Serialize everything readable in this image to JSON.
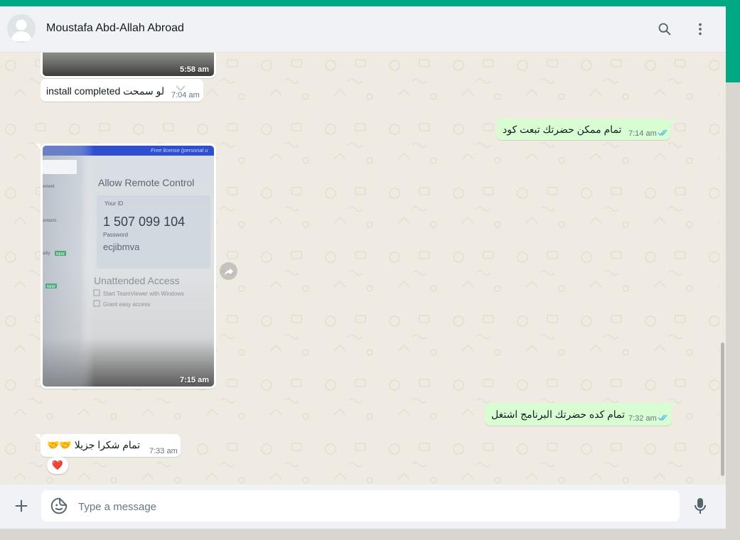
{
  "header": {
    "contact_name": "Moustafa Abd-Allah Abroad",
    "icons": [
      "search-icon",
      "menu-icon"
    ]
  },
  "messages": [
    {
      "id": "m0",
      "direction": "in",
      "type": "image",
      "time": "5:58 am"
    },
    {
      "id": "m1",
      "direction": "in",
      "type": "text",
      "text": "install completed لو سمحت",
      "time": "7:04 am"
    },
    {
      "id": "m2",
      "direction": "out",
      "type": "text",
      "text": "تمام ممكن حضرتك تبعت كود",
      "time": "7:14 am",
      "status": "read"
    },
    {
      "id": "m3",
      "direction": "in",
      "type": "image",
      "time": "7:15 am",
      "image_text": {
        "watermark": "Free license (personal u",
        "heading": "Allow Remote Control",
        "your_id_label": "Your ID",
        "your_id": "1 507 099 104",
        "password_label": "Password",
        "password": "ecjibmva",
        "unattended": "Unattended Access",
        "start_tv": "Start TeamViewer with Windows",
        "grant": "Grant easy access",
        "side_items": [
          "ement",
          "ontacts",
          "ality",
          "NEW",
          "NEW"
        ]
      }
    },
    {
      "id": "m4",
      "direction": "out",
      "type": "text",
      "text": "تمام كده حضرتك البرنامج اشتغل",
      "time": "7:32 am",
      "status": "read"
    },
    {
      "id": "m5",
      "direction": "in",
      "type": "text",
      "text": "تمام شكرا جزيلا 🤝🤝",
      "time": "7:33 am",
      "reaction": "❤️"
    }
  ],
  "composer": {
    "placeholder": "Type a message",
    "icons": [
      "plus-icon",
      "sticker-icon",
      "microphone-icon"
    ]
  },
  "colors": {
    "accent": "#00a884",
    "outgoing_bubble": "#d9fdd3",
    "incoming_bubble": "#ffffff",
    "chat_background": "#efeae2",
    "read_ticks": "#53bdeb"
  }
}
